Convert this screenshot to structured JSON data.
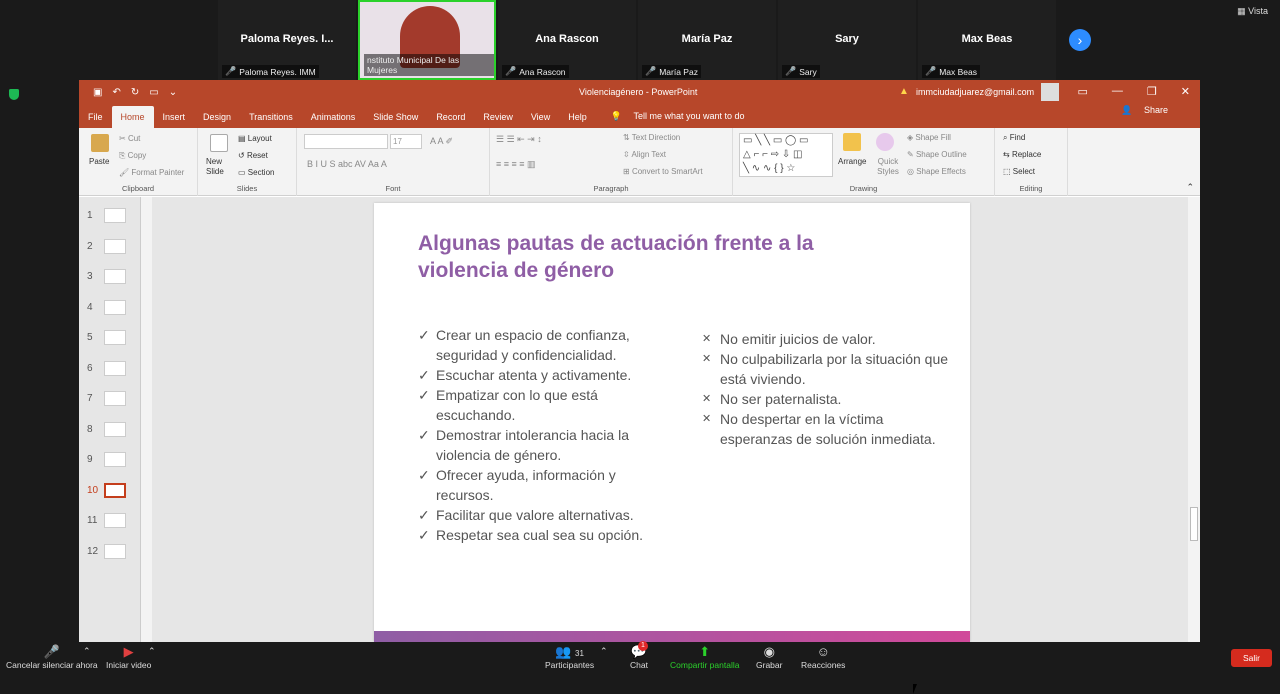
{
  "zoom_top": {
    "participants": [
      {
        "big": "Paloma Reyes. I...",
        "small": "Paloma Reyes. IMM",
        "video": false
      },
      {
        "big": "",
        "small": "nstituto Municipal De las Mujeres",
        "video": true
      },
      {
        "big": "Ana Rascon",
        "small": "Ana Rascon",
        "video": false
      },
      {
        "big": "María Paz",
        "small": "María Paz",
        "video": false
      },
      {
        "big": "Sary",
        "small": "Sary",
        "video": false
      },
      {
        "big": "Max Beas",
        "small": "Max Beas",
        "video": false
      }
    ],
    "view_label": "Vista"
  },
  "ppt": {
    "title": "Violenciagénero  -  PowerPoint",
    "account": "immciudadjuarez@gmail.com",
    "tabs": [
      "File",
      "Home",
      "Insert",
      "Design",
      "Transitions",
      "Animations",
      "Slide Show",
      "Record",
      "Review",
      "View",
      "Help"
    ],
    "active_tab": "Home",
    "tell_me": "Tell me what you want to do",
    "share": "Share",
    "ribbon": {
      "clipboard": {
        "paste": "Paste",
        "cut": "Cut",
        "copy": "Copy",
        "format_painter": "Format Painter",
        "label": "Clipboard"
      },
      "slides": {
        "new_slide": "New Slide",
        "layout": "Layout",
        "reset": "Reset",
        "section": "Section",
        "label": "Slides"
      },
      "font": {
        "label": "Font",
        "size": "17"
      },
      "paragraph": {
        "text_direction": "Text Direction",
        "align_text": "Align Text",
        "smartart": "Convert to SmartArt",
        "label": "Paragraph"
      },
      "drawing": {
        "arrange": "Arrange",
        "quick_styles": "Quick Styles",
        "shape_fill": "Shape Fill",
        "shape_outline": "Shape Outline",
        "shape_effects": "Shape Effects",
        "label": "Drawing"
      },
      "editing": {
        "find": "Find",
        "replace": "Replace",
        "select": "Select",
        "label": "Editing"
      }
    },
    "thumbnails": [
      "1",
      "2",
      "3",
      "4",
      "5",
      "6",
      "7",
      "8",
      "9",
      "10",
      "11",
      "12"
    ],
    "selected_slide": "10",
    "slide": {
      "title": "Algunas pautas de actuación frente a la violencia de género",
      "left_items": [
        "Crear un espacio de confianza, seguridad y confidencialidad.",
        "Escuchar atenta y activamente.",
        "Empatizar con lo que está escuchando.",
        "Demostrar intolerancia hacia la violencia de género.",
        "Ofrecer ayuda, información y recursos.",
        "Facilitar que valore alternativas.",
        "Respetar sea cual sea su opción."
      ],
      "right_items": [
        "No emitir juicios de valor.",
        "No culpabilizarla por la situación que está viviendo.",
        "No ser paternalista.",
        "No despertar en la víctima esperanzas de solución inmediata."
      ]
    }
  },
  "zoom_bottom": {
    "unmute": "Cancelar silenciar ahora",
    "start_video": "Iniciar video",
    "participants": "Participantes",
    "participant_count": "31",
    "chat": "Chat",
    "chat_badge": "1",
    "share": "Compartir pantalla",
    "record": "Grabar",
    "reactions": "Reacciones",
    "leave": "Salir",
    "share_color": "#2bd12b"
  }
}
